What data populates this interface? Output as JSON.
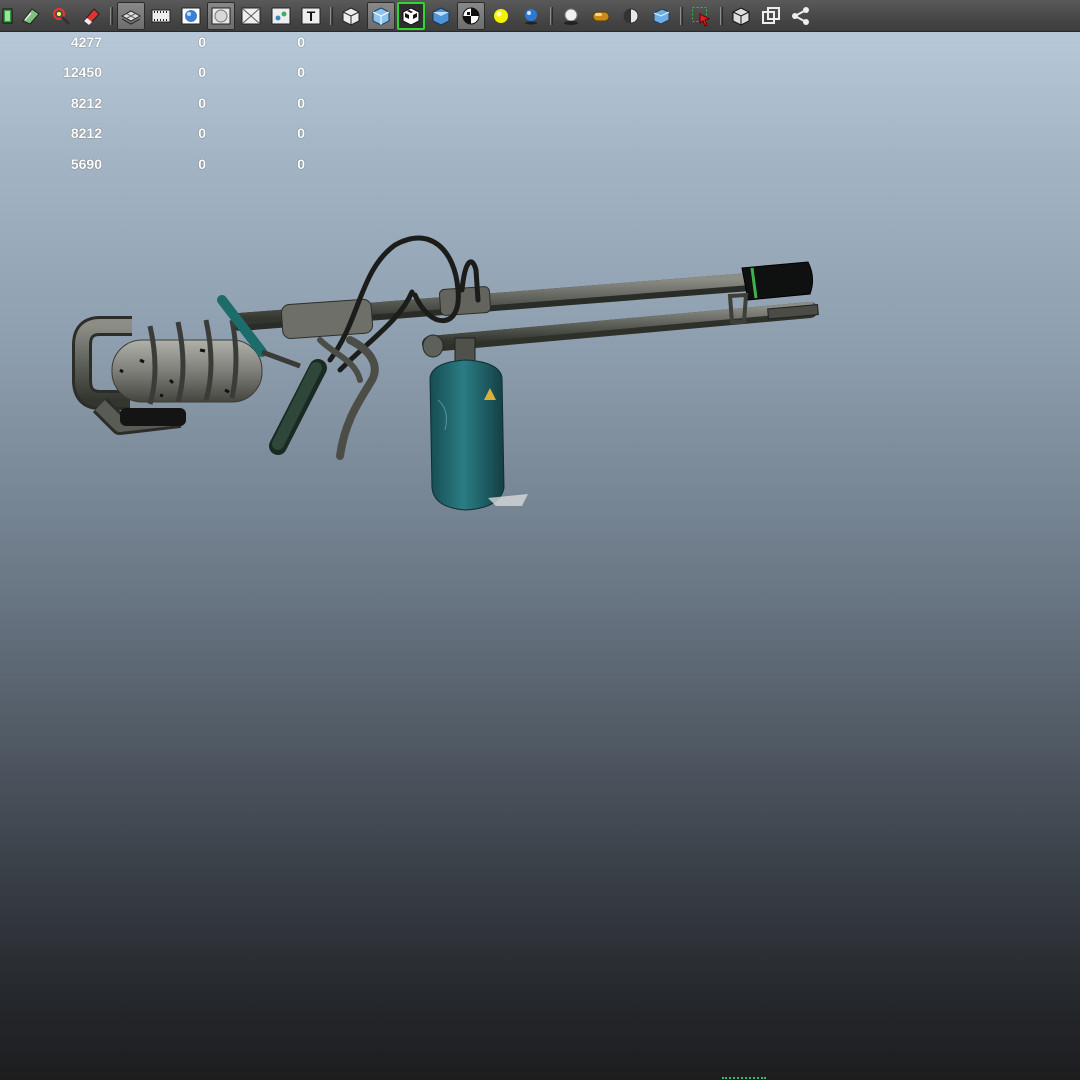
{
  "toolbar": {
    "groups": [
      [
        "outliner-icon",
        "uv-layout-icon",
        "paint-effects-icon",
        "eraser-icon"
      ],
      [
        "wireframe-grid-icon",
        "film-strip-icon",
        "sphere-shaded-icon",
        "sphere-outline-icon",
        "xray-icon",
        "uv-snapshot-icon",
        "text-icon"
      ],
      [
        "cube-wire-icon",
        "cube-shaded-icon",
        "cube-checker-selected-icon",
        "cube-blue-icon",
        "checker-ball-icon",
        "light-bulb-icon",
        "blue-sphere-icon"
      ],
      [
        "white-sphere-icon",
        "capsule-icon",
        "half-sphere-icon",
        "blue-box-icon"
      ],
      [
        "select-region-icon"
      ],
      [
        "cube-outline-icon",
        "duplicate-icon",
        "share-node-icon"
      ]
    ],
    "text_button_label": "T"
  },
  "hud": {
    "rows": [
      [
        "4277",
        "0",
        "0"
      ],
      [
        "12450",
        "0",
        "0"
      ],
      [
        "8212",
        "0",
        "0"
      ],
      [
        "8212",
        "0",
        "0"
      ],
      [
        "5690",
        "0",
        "0"
      ]
    ]
  },
  "scene": {
    "model": "flamethrower",
    "tank_color": "#1e6a70",
    "metal_color": "#5a5c55",
    "viewport_gradient_top": "#b7c8d8",
    "viewport_gradient_bottom": "#1c1d1f"
  }
}
